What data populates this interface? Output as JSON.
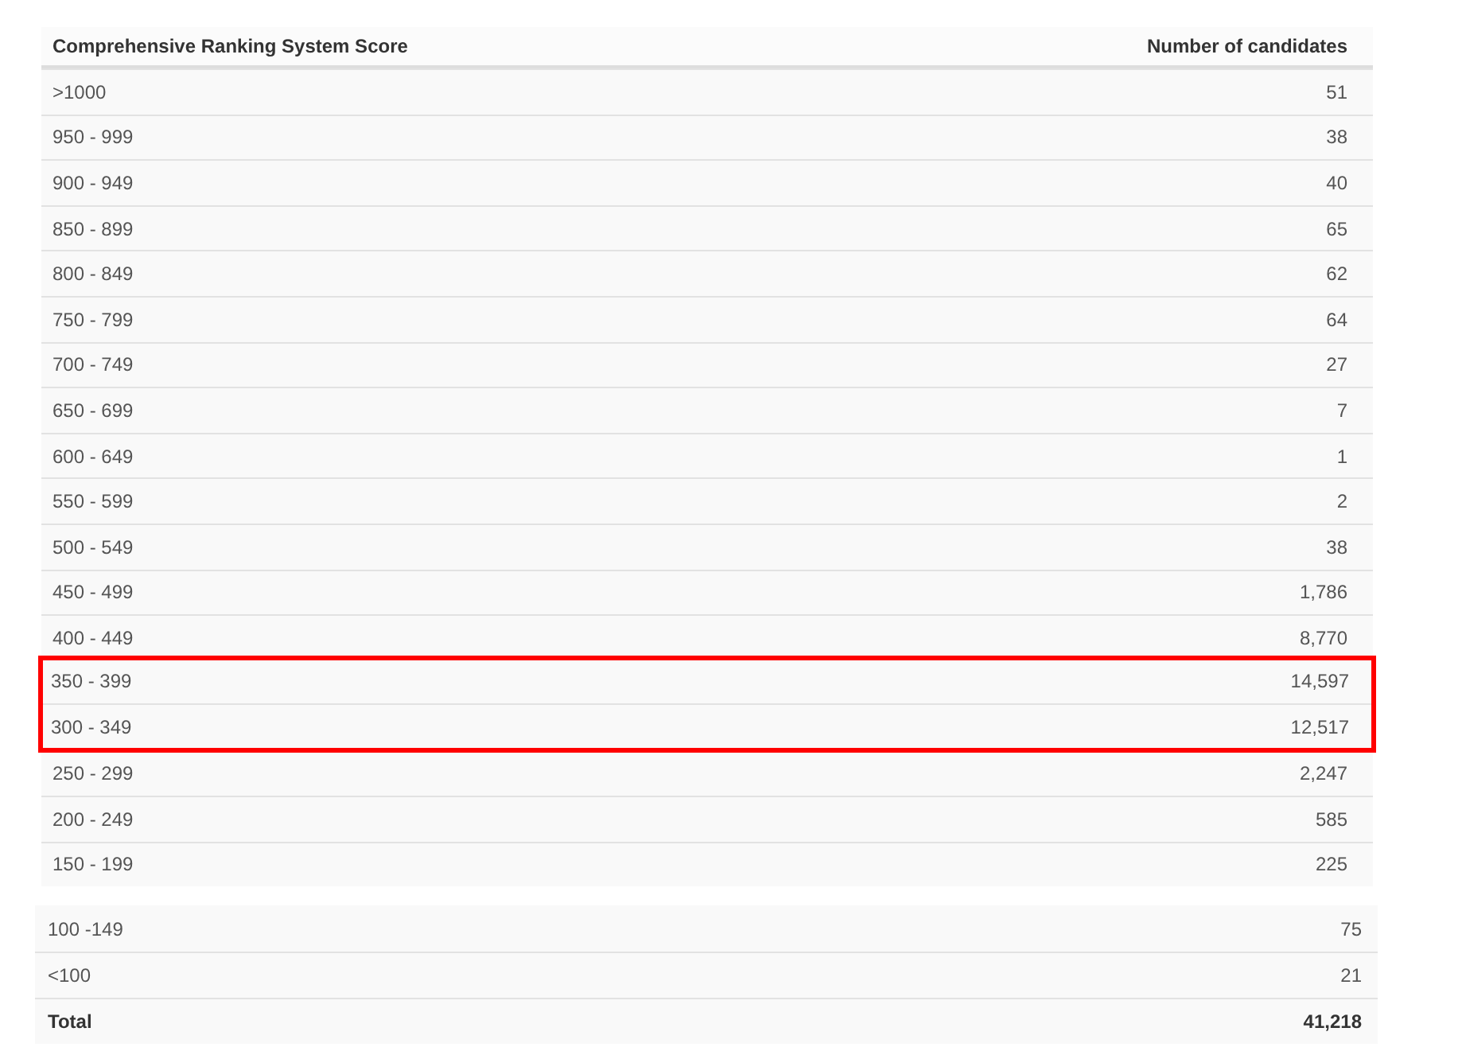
{
  "score_table": {
    "columns": [
      "Comprehensive Ranking System Score",
      "Number of candidates"
    ],
    "rows": [
      {
        "score": ">1000",
        "count": "51",
        "highlighted": false
      },
      {
        "score": "950 - 999",
        "count": "38",
        "highlighted": false
      },
      {
        "score": "900 - 949",
        "count": "40",
        "highlighted": false
      },
      {
        "score": "850 - 899",
        "count": "65",
        "highlighted": false
      },
      {
        "score": "800 - 849",
        "count": "62",
        "highlighted": false
      },
      {
        "score": "750 - 799",
        "count": "64",
        "highlighted": false
      },
      {
        "score": "700 - 749",
        "count": "27",
        "highlighted": false
      },
      {
        "score": "650 - 699",
        "count": "7",
        "highlighted": false
      },
      {
        "score": "600 - 649",
        "count": "1",
        "highlighted": false
      },
      {
        "score": "550 - 599",
        "count": "2",
        "highlighted": false
      },
      {
        "score": "500 - 549",
        "count": "38",
        "highlighted": false
      },
      {
        "score": "450 - 499",
        "count": "1,786",
        "highlighted": false
      },
      {
        "score": "400 - 449",
        "count": "8,770",
        "highlighted": false
      },
      {
        "score": "350 - 399",
        "count": "14,597",
        "highlighted": true
      },
      {
        "score": "300 - 349",
        "count": "12,517",
        "highlighted": true
      },
      {
        "score": "250 - 299",
        "count": "2,247",
        "highlighted": false
      },
      {
        "score": "200 - 249",
        "count": "585",
        "highlighted": false
      },
      {
        "score": "150 - 199",
        "count": "225",
        "highlighted": false
      }
    ]
  },
  "lower_table": {
    "rows": [
      {
        "score": "100 -149",
        "count": "75"
      },
      {
        "score": "<100",
        "count": "21"
      }
    ],
    "total": {
      "label": "Total",
      "value": "41,218"
    }
  }
}
